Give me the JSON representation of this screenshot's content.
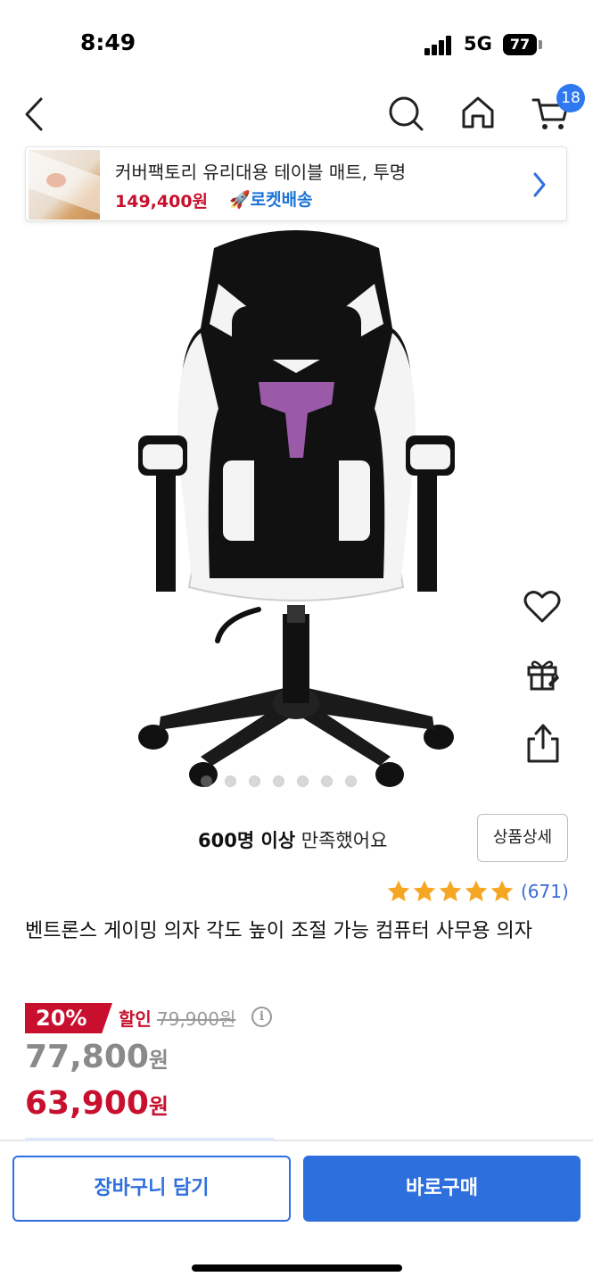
{
  "status_bar": {
    "time": "8:49",
    "network": "5G",
    "battery": "77"
  },
  "nav": {
    "cart_badge": "18"
  },
  "recent_banner": {
    "title": "커버팩토리 유리대용 테이블 매트, 투명",
    "price": "149,400원",
    "delivery_badge": "🚀로켓배송"
  },
  "gallery": {
    "dot_count": 7,
    "active_index": 0
  },
  "satisfaction": {
    "bold": "600명 이상",
    "rest": " 만족했어요"
  },
  "detail_button": "상품상세",
  "rating": {
    "stars": 5,
    "review_count": "(671)"
  },
  "product": {
    "title": "벤트론스 게이밍 의자 각도 높이 조절 가능 컴퓨터 사무용 의자",
    "discount_rate": "20%",
    "discount_label": "할인",
    "original_price": "79,900원",
    "price_before_coupon": "77,800",
    "price_final": "63,900",
    "currency": "원"
  },
  "actions": {
    "add_to_cart": "장바구니 담기",
    "buy_now": "바로구매"
  },
  "colors": {
    "accent_blue": "#2e6fde",
    "sale_red": "#c8102e",
    "star": "#f5a623"
  }
}
